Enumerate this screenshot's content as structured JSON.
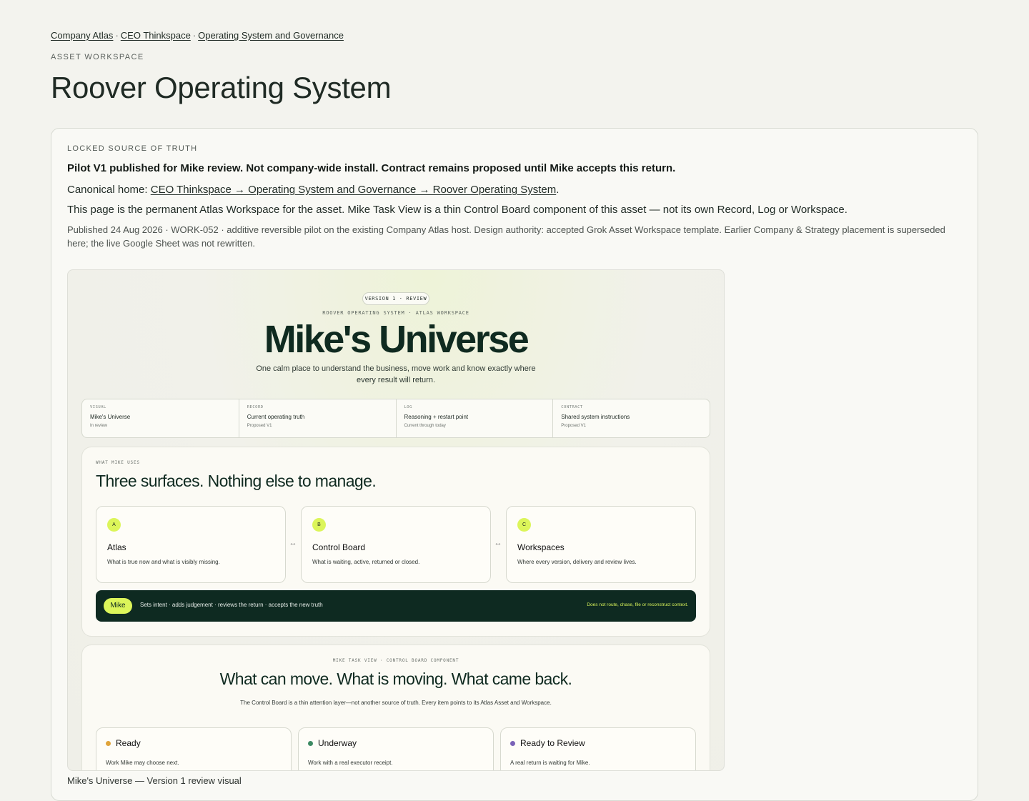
{
  "breadcrumb": {
    "items": [
      "Company Atlas",
      "CEO Thinkspace",
      "Operating System and Governance"
    ],
    "separator": "·"
  },
  "header": {
    "eyebrow": "ASSET WORKSPACE",
    "title": "Roover Operating System"
  },
  "source": {
    "label": "LOCKED SOURCE OF TRUTH",
    "lead": "Pilot V1 published for Mike review. Not company-wide install. Contract remains proposed until Mike accepts this return.",
    "canonical_prefix": "Canonical home: ",
    "canonical_link": "CEO Thinkspace → Operating System and Governance → Roover Operating System",
    "canonical_suffix": ".",
    "permanent": "This page is the permanent Atlas Workspace for the asset. Mike Task View is a thin Control Board component of this asset — not its own Record, Log or Workspace.",
    "meta": "Published 24 Aug 2026 · WORK-052 · additive reversible pilot on the existing Company Atlas host. Design authority: accepted Grok Asset Workspace template. Earlier Company & Strategy placement is superseded here; the live Google Sheet was not rewritten."
  },
  "visual": {
    "badge": "VERSION 1 · REVIEW",
    "eyebrow": "ROOVER OPERATING SYSTEM · ATLAS WORKSPACE",
    "title": "Mike's Universe",
    "subtitle": "One calm place to understand the business, move work and know exactly where every result will return.",
    "strip": [
      {
        "label": "VISUAL",
        "value": "Mike's Universe",
        "status": "In review"
      },
      {
        "label": "RECORD",
        "value": "Current operating truth",
        "status": "Proposed V1"
      },
      {
        "label": "LOG",
        "value": "Reasoning + restart point",
        "status": "Current through today"
      },
      {
        "label": "CONTRACT",
        "value": "Shared system instructions",
        "status": "Proposed V1"
      }
    ],
    "uses": {
      "eyebrow": "WHAT MIKE USES",
      "title": "Three surfaces. Nothing else to manage.",
      "surfaces": [
        {
          "letter": "A",
          "name": "Atlas",
          "desc": "What is true now and what is visibly missing."
        },
        {
          "letter": "B",
          "name": "Control Board",
          "desc": "What is waiting, active, returned or closed."
        },
        {
          "letter": "C",
          "name": "Workspaces",
          "desc": "Where every version, delivery and review lives."
        }
      ],
      "arrow": "↔",
      "mike": {
        "pill": "Mike",
        "text": "Sets intent · adds judgement · reviews the return · accepts the new truth",
        "note": "Does not route, chase, file or reconstruct context."
      }
    },
    "task": {
      "eyebrow": "MIKE TASK VIEW · CONTROL BOARD COMPONENT",
      "title": "What can move. What is moving. What came back.",
      "subtitle": "The Control Board is a thin attention layer—not another source of truth. Every item points to its Atlas Asset and Workspace.",
      "statuses": [
        {
          "name": "Ready",
          "desc": "Work Mike may choose next.",
          "color": "#e0a43a"
        },
        {
          "name": "Underway",
          "desc": "Work with a real executor receipt.",
          "color": "#3d8a63"
        },
        {
          "name": "Ready to Review",
          "desc": "A real return is waiting for Mike.",
          "color": "#7a63b8"
        }
      ]
    }
  },
  "caption": "Mike's Universe — Version 1 review visual"
}
